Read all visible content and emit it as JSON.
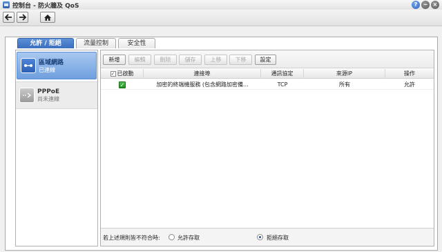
{
  "window": {
    "title": "控制台 - 防火牆及 QoS",
    "help_icon": "?",
    "min_icon": "−",
    "close_icon": "×"
  },
  "toolbar": {
    "back_icon": "arrow-left",
    "forward_icon": "arrow-right",
    "home_icon": "house"
  },
  "tabs": [
    {
      "label": "允許 / 拒絕",
      "active": true
    },
    {
      "label": "流量控制",
      "active": false
    },
    {
      "label": "安全性",
      "active": false
    }
  ],
  "sidebar": {
    "items": [
      {
        "label": "區域網路",
        "status": "已連線",
        "selected": true
      },
      {
        "label": "PPPoE",
        "status": "尚未連線",
        "selected": false
      }
    ]
  },
  "actions": {
    "create": "新增",
    "edit": "編輯",
    "delete": "刪除",
    "save": "儲存",
    "up": "上移",
    "down": "下移",
    "settings": "設定"
  },
  "grid": {
    "headers": {
      "enabled": "已啟動",
      "ports": "連接埠",
      "protocol": "通訊協定",
      "source_ip": "來源IP",
      "action": "操作"
    },
    "rows": [
      {
        "enabled": "✓",
        "ports": "加密的終端機服務 (包含網路加密備...",
        "protocol": "TCP",
        "source_ip": "所有",
        "action": "允許"
      }
    ]
  },
  "footer": {
    "label": "若上述規則皆不符合時:",
    "allow": "允許存取",
    "deny": "拒絕存取",
    "selected": "deny"
  },
  "colors": {
    "accent": "#3b6fc0",
    "check_green": "#2a9a2a"
  }
}
